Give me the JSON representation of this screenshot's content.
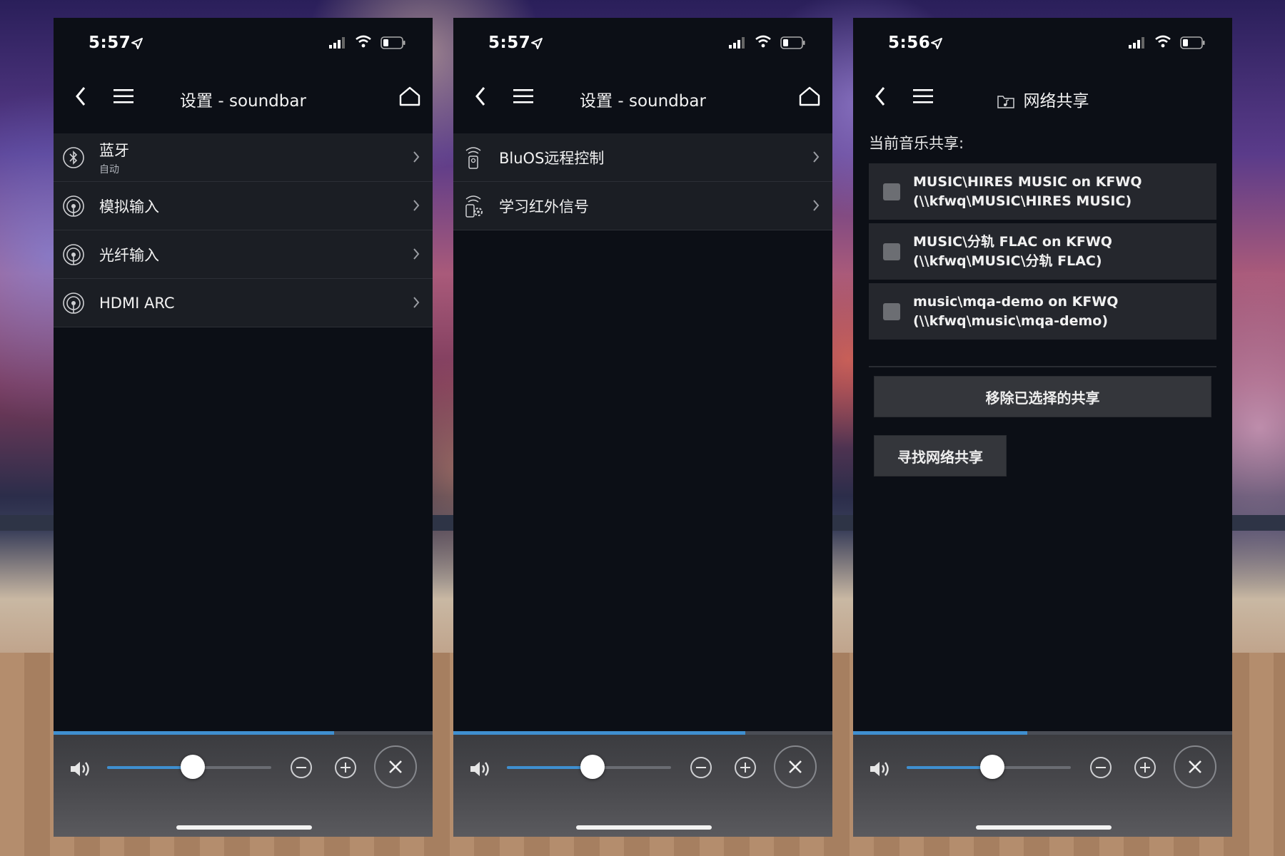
{
  "colors": {
    "accent": "#3f8fd0",
    "panel": "#0c0f16",
    "row": "#1b1e24"
  },
  "phones": [
    {
      "time": "5:57",
      "title": "设置 - soundbar",
      "rows": [
        {
          "icon": "bluetooth-icon",
          "label": "蓝牙",
          "sub": "自动"
        },
        {
          "icon": "input-icon",
          "label": "模拟输入"
        },
        {
          "icon": "input-icon",
          "label": "光纤输入"
        },
        {
          "icon": "input-icon",
          "label": "HDMI ARC"
        }
      ],
      "progress": 0.74,
      "volume": 0.52
    },
    {
      "time": "5:57",
      "title": "设置 - soundbar",
      "rows": [
        {
          "icon": "remote-control-icon",
          "label": "BluOS远程控制"
        },
        {
          "icon": "infrared-settings-icon",
          "label": "学习红外信号"
        }
      ],
      "progress": 0.77,
      "volume": 0.52
    },
    {
      "time": "5:56",
      "title": "网络共享",
      "title_icon": "folder-music-icon",
      "share_heading": "当前音乐共享:",
      "shares": [
        {
          "line1": "MUSIC\\HIRES MUSIC on KFWQ",
          "line2": "(\\\\kfwq\\MUSIC\\HIRES MUSIC)"
        },
        {
          "line1": "MUSIC\\分轨 FLAC on KFWQ",
          "line2": "(\\\\kfwq\\MUSIC\\分轨 FLAC)"
        },
        {
          "line1": "music\\mqa-demo on KFWQ",
          "line2": "(\\\\kfwq\\music\\mqa-demo)"
        }
      ],
      "remove_button": "移除已选择的共享",
      "find_button": "寻找网络共享",
      "progress": 0.46,
      "volume": 0.52
    }
  ]
}
